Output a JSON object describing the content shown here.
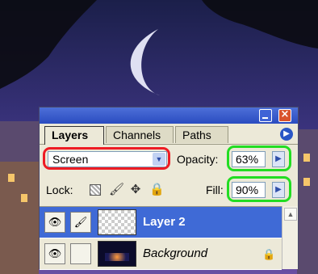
{
  "panel": {
    "tabs": [
      {
        "label": "Layers",
        "active": true
      },
      {
        "label": "Channels",
        "active": false
      },
      {
        "label": "Paths",
        "active": false
      }
    ],
    "menu_icon": "triangle-right-icon"
  },
  "blend": {
    "selected": "Screen"
  },
  "opacity": {
    "label": "Opacity:",
    "value": "63%"
  },
  "lock": {
    "label": "Lock:"
  },
  "fill": {
    "label": "Fill:",
    "value": "90%"
  },
  "layers": [
    {
      "name": "Layer 2",
      "selected": true
    },
    {
      "name": "Background",
      "selected": false,
      "locked": true
    }
  ],
  "annotation_colors": {
    "blend_highlight": "#ee1c24",
    "value_highlight": "#22dd22",
    "selected_layer": "#3f6ad6"
  }
}
